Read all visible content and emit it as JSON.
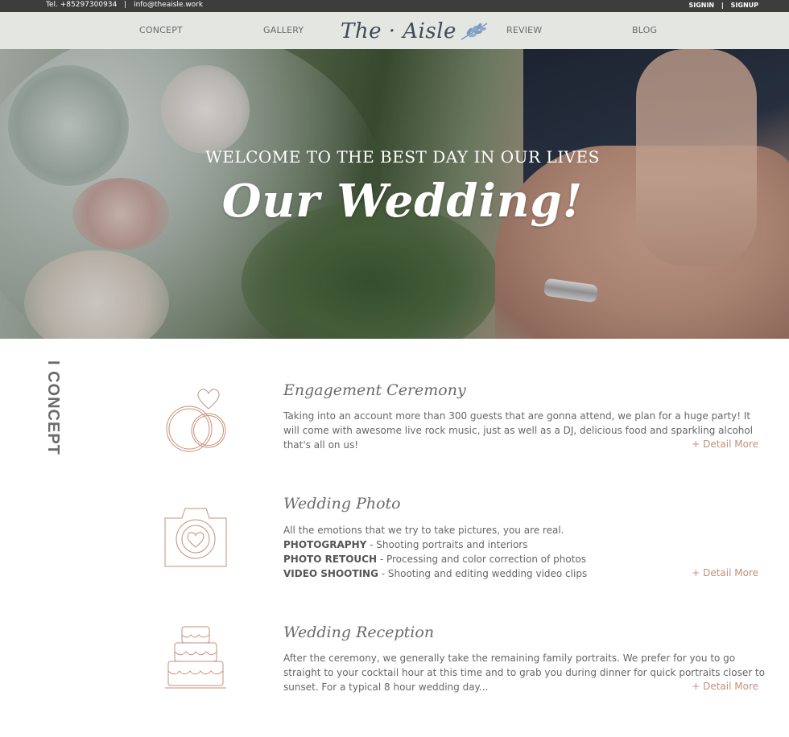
{
  "topbar": {
    "phone": "Tel. +85297300934",
    "email": "info@theaisle.work",
    "signin": "SIGNIN",
    "signup": "SIGNUP",
    "separator": "|"
  },
  "nav": {
    "logo": "The · Aisle",
    "items": [
      "CONCEPT",
      "GALLERY",
      "REVIEW",
      "BLOG"
    ]
  },
  "hero": {
    "subtitle": "WELCOME TO THE BEST DAY IN OUR LIVES",
    "title": "Our Wedding!"
  },
  "concept_label": "I CONCEPT",
  "items": [
    {
      "heading": "Engagement Ceremony",
      "text": "Taking into an account more than 300 guests that are gonna attend, we plan for a huge party! It will come with awesome live rock music, just as well as a DJ, delicious food and sparkling alcohol that's all on us!",
      "more": "+ Detail More",
      "icon": "rings-heart-icon"
    },
    {
      "heading": "Wedding Photo",
      "intro": "All the emotions that we try to take pictures, you are real.",
      "lines": [
        {
          "label": "PHOTOGRAPHY",
          "desc": " - Shooting portraits and interiors"
        },
        {
          "label": "PHOTO RETOUCH",
          "desc": " - Processing and color correction of photos"
        },
        {
          "label": "VIDEO SHOOTING",
          "desc": " - Shooting and editing wedding video clips"
        }
      ],
      "more": "+ Detail More",
      "icon": "camera-heart-icon"
    },
    {
      "heading": "Wedding Reception",
      "text": "After the ceremony, we generally take the remaining family portraits. We prefer for you to go straight to your cocktail hour at this time and to grab you during dinner for quick portraits closer to sunset. For a typical 8 hour wedding day...",
      "more": "+ Detail More",
      "icon": "wedding-cake-icon"
    }
  ],
  "colors": {
    "topbar_bg": "#3d3d3d",
    "nav_bg": "#e3e6e1",
    "accent": "#c4907a",
    "icon_stroke": "#c4907a",
    "logo": "#3f4a5a",
    "leaf": "#7d9bc2"
  }
}
